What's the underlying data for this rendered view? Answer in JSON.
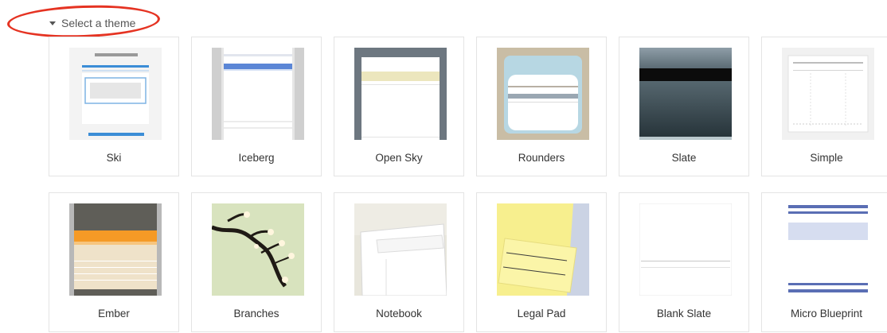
{
  "header": {
    "label": "Select a theme",
    "caret_icon": "caret-down-icon"
  },
  "annotation": {
    "shape": "ellipse",
    "color": "#e53322"
  },
  "themes": [
    {
      "label": "Ski"
    },
    {
      "label": "Iceberg"
    },
    {
      "label": "Open Sky"
    },
    {
      "label": "Rounders"
    },
    {
      "label": "Slate"
    },
    {
      "label": "Simple"
    },
    {
      "label": "Ember"
    },
    {
      "label": "Branches"
    },
    {
      "label": "Notebook"
    },
    {
      "label": "Legal Pad"
    },
    {
      "label": "Blank Slate"
    },
    {
      "label": "Micro Blueprint"
    }
  ]
}
